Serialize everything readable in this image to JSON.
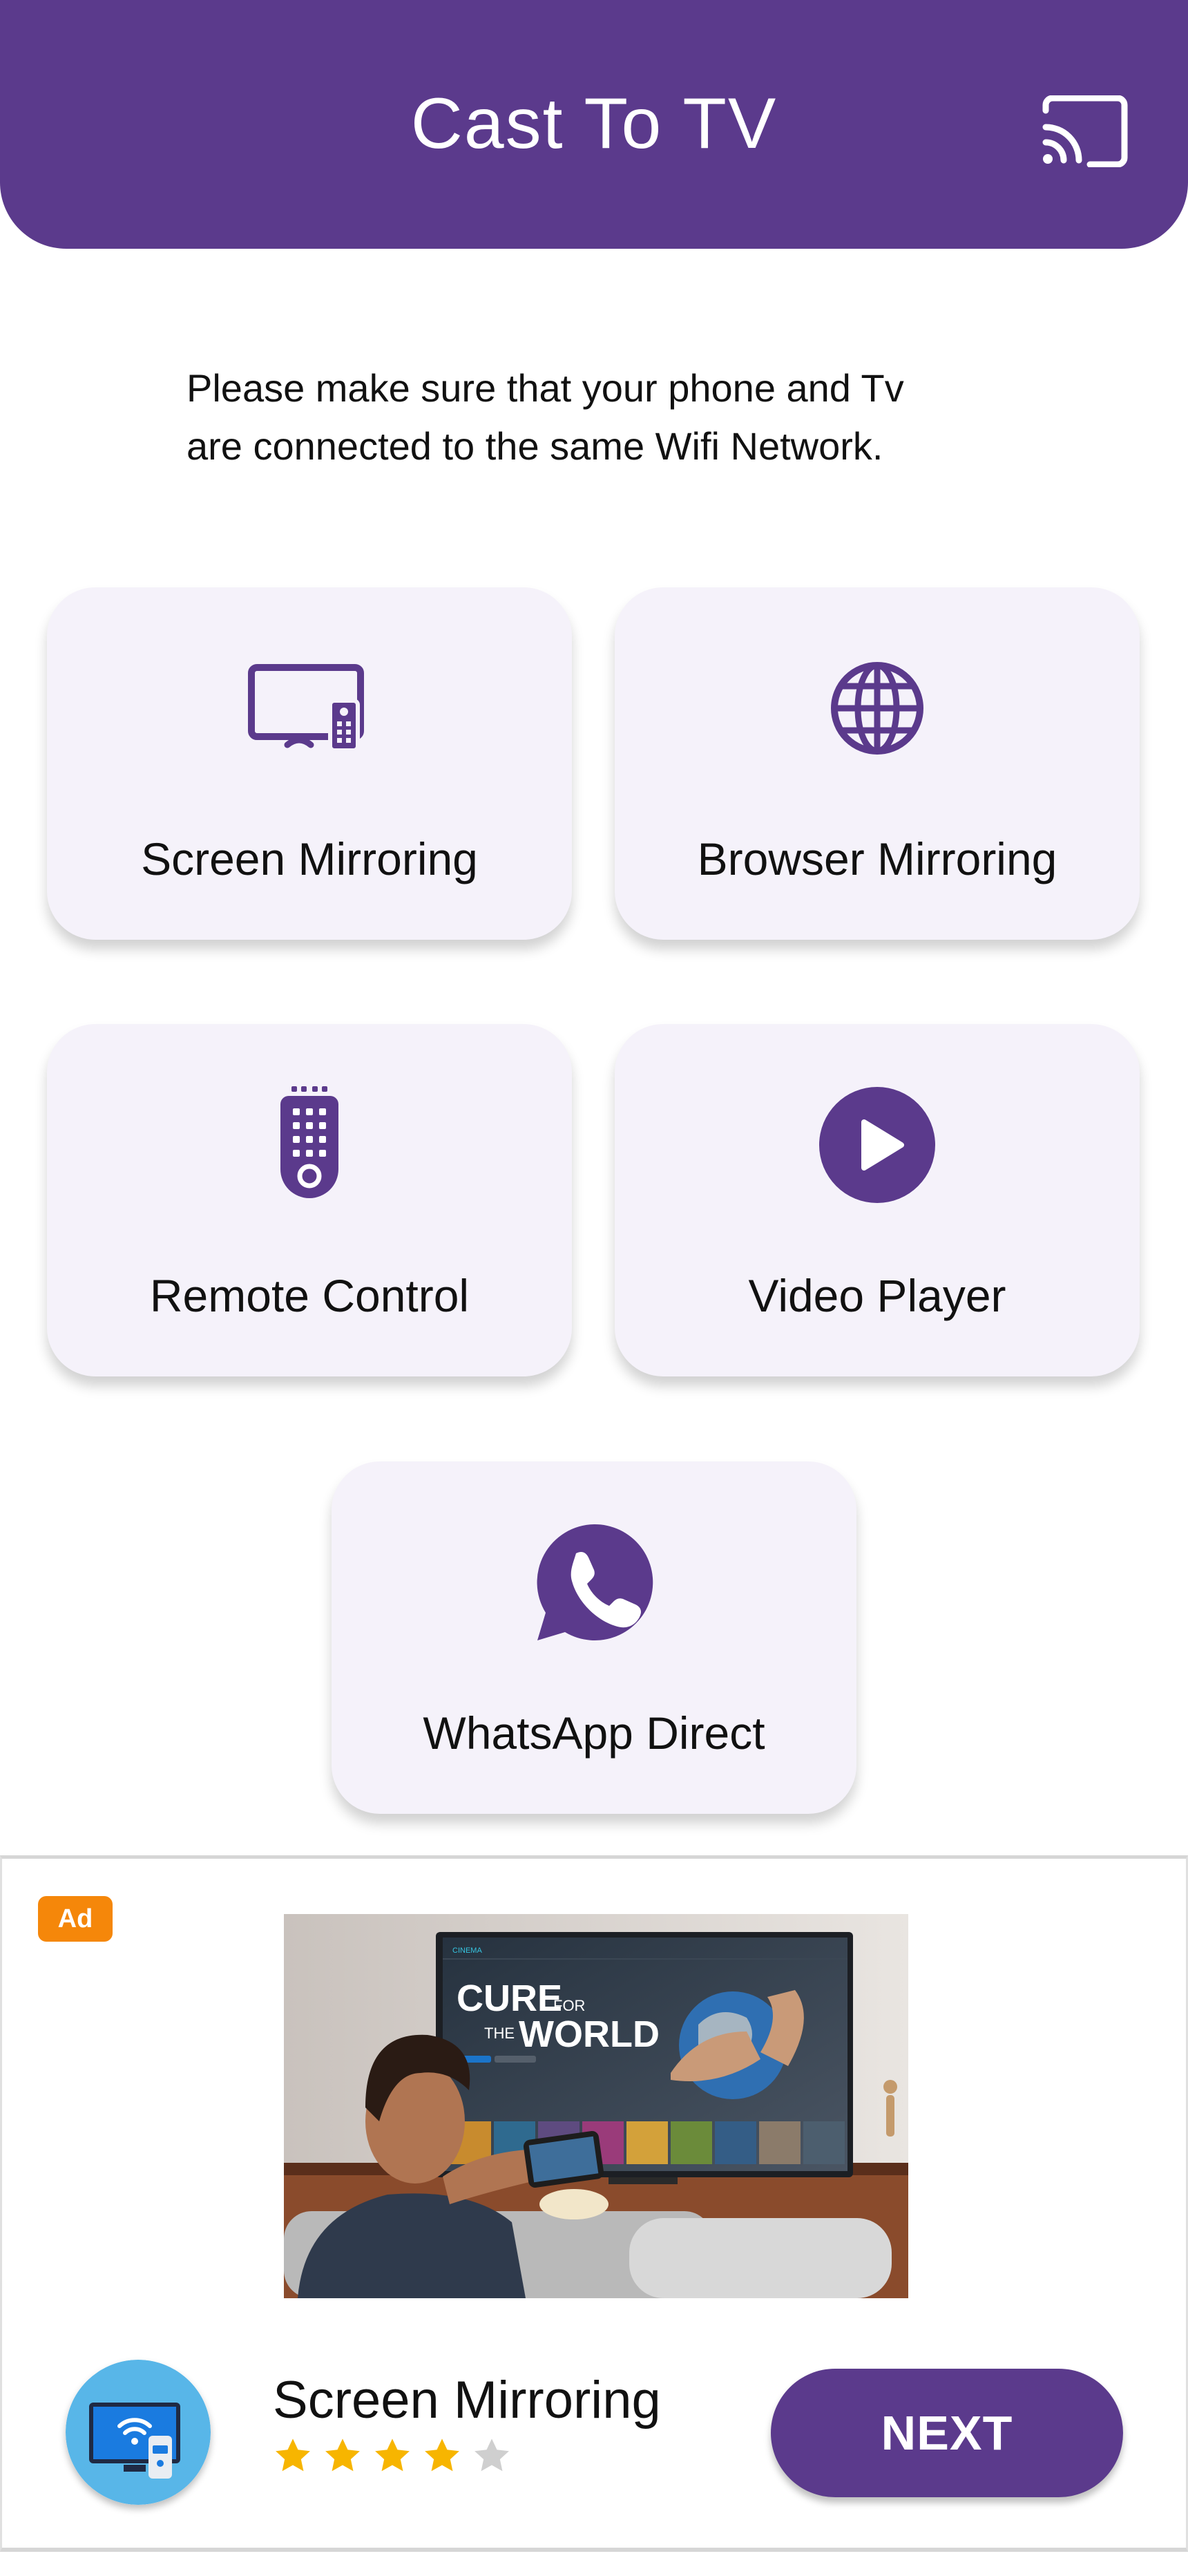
{
  "header": {
    "title": "Cast To TV",
    "cast_icon": "cast-icon"
  },
  "notice": {
    "line1": "Please make sure that your phone and Tv",
    "line2": "are connected to the same Wifi Network."
  },
  "features": [
    {
      "label": "Screen Mirroring",
      "icon": "tv-remote-icon"
    },
    {
      "label": "Browser Mirroring",
      "icon": "globe-icon"
    },
    {
      "label": "Remote Control",
      "icon": "remote-control-icon"
    },
    {
      "label": "Video Player",
      "icon": "play-icon"
    },
    {
      "label": "WhatsApp Direct",
      "icon": "whatsapp-icon"
    }
  ],
  "ad": {
    "badge": "Ad",
    "image_title_line1": "CURE",
    "image_title_for": "FOR",
    "image_title_the": "THE",
    "image_title_line2": "WORLD",
    "image_brand": "CINEMA",
    "app_name": "Screen Mirroring",
    "rating": 4,
    "rating_max": 5,
    "cta": "NEXT"
  },
  "colors": {
    "primary": "#5b3a8c",
    "card_bg": "#f5f2fa",
    "ad_badge": "#f5870a",
    "star_filled": "#f7b500",
    "star_empty": "#cfcfcf"
  }
}
